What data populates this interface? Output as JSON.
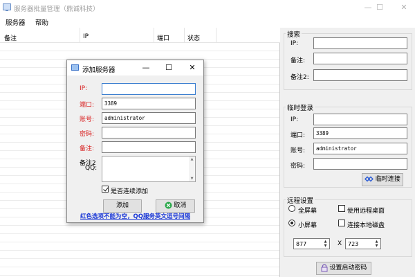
{
  "window": {
    "title": "服务器批量管理（鼎诚科技）",
    "minimize_glyph": "—",
    "maximize_glyph": "☐",
    "close_glyph": "✕"
  },
  "menu": {
    "items": [
      {
        "label": "服务器"
      },
      {
        "label": "帮助"
      }
    ]
  },
  "list": {
    "columns": [
      {
        "label": "备注"
      },
      {
        "label": "IP"
      },
      {
        "label": "端口"
      },
      {
        "label": "状态"
      }
    ]
  },
  "search": {
    "title": "搜索",
    "ip_label": "IP:",
    "ip_value": "",
    "note_label": "备注:",
    "note_value": "",
    "note2_label": "备注2:",
    "note2_value": ""
  },
  "temp_login": {
    "title": "临时登录",
    "ip_label": "IP:",
    "ip_value": "",
    "port_label": "端口:",
    "port_value": "3389",
    "account_label": "账号:",
    "account_value": "administrator",
    "password_label": "密码:",
    "password_value": "",
    "connect_button": "临时连接"
  },
  "remote_settings": {
    "title": "远程设置",
    "fullscreen_label": "全屏幕",
    "fullscreen_selected": false,
    "smallscreen_label": "小屏幕",
    "smallscreen_selected": true,
    "use_remote_desktop_label": "使用远程桌面",
    "use_remote_desktop_checked": false,
    "connect_local_disk_label": "连接本地磁盘",
    "connect_local_disk_checked": false,
    "width_value": "877",
    "x_label": "X",
    "height_value": "723"
  },
  "startup_password_button": "设置启动密码",
  "dialog": {
    "title": "添加服务器",
    "minimize_glyph": "—",
    "maximize_glyph": "☐",
    "close_glyph": "✕",
    "ip_label": "IP:",
    "ip_value": "",
    "port_label": "端口:",
    "port_value": "3389",
    "account_label": "账号:",
    "account_value": "administrator",
    "password_label": "密码:",
    "password_value": "",
    "note_label": "备注:",
    "note_value": "",
    "note2_label": "备注2",
    "qq_label": "QQ:",
    "note2_value": "",
    "continuous_label": "是否连续添加",
    "continuous_checked": true,
    "add_button": "添加",
    "cancel_button": "取消",
    "hint_text": "红色选项不能为空，QQ服务英文逗号间隔"
  },
  "colors": {
    "required_label": "#d81e1e",
    "hint_link": "#1836d6",
    "cancel_icon": "#2aa84a",
    "connect_icon": "#2f5fd6",
    "lock_icon": "#7a5cb8"
  },
  "icons": {
    "app": "monitor-icon",
    "dialog": "monitor-icon",
    "connect": "link-icon",
    "cancel": "cancel-icon",
    "lock": "lock-icon"
  }
}
